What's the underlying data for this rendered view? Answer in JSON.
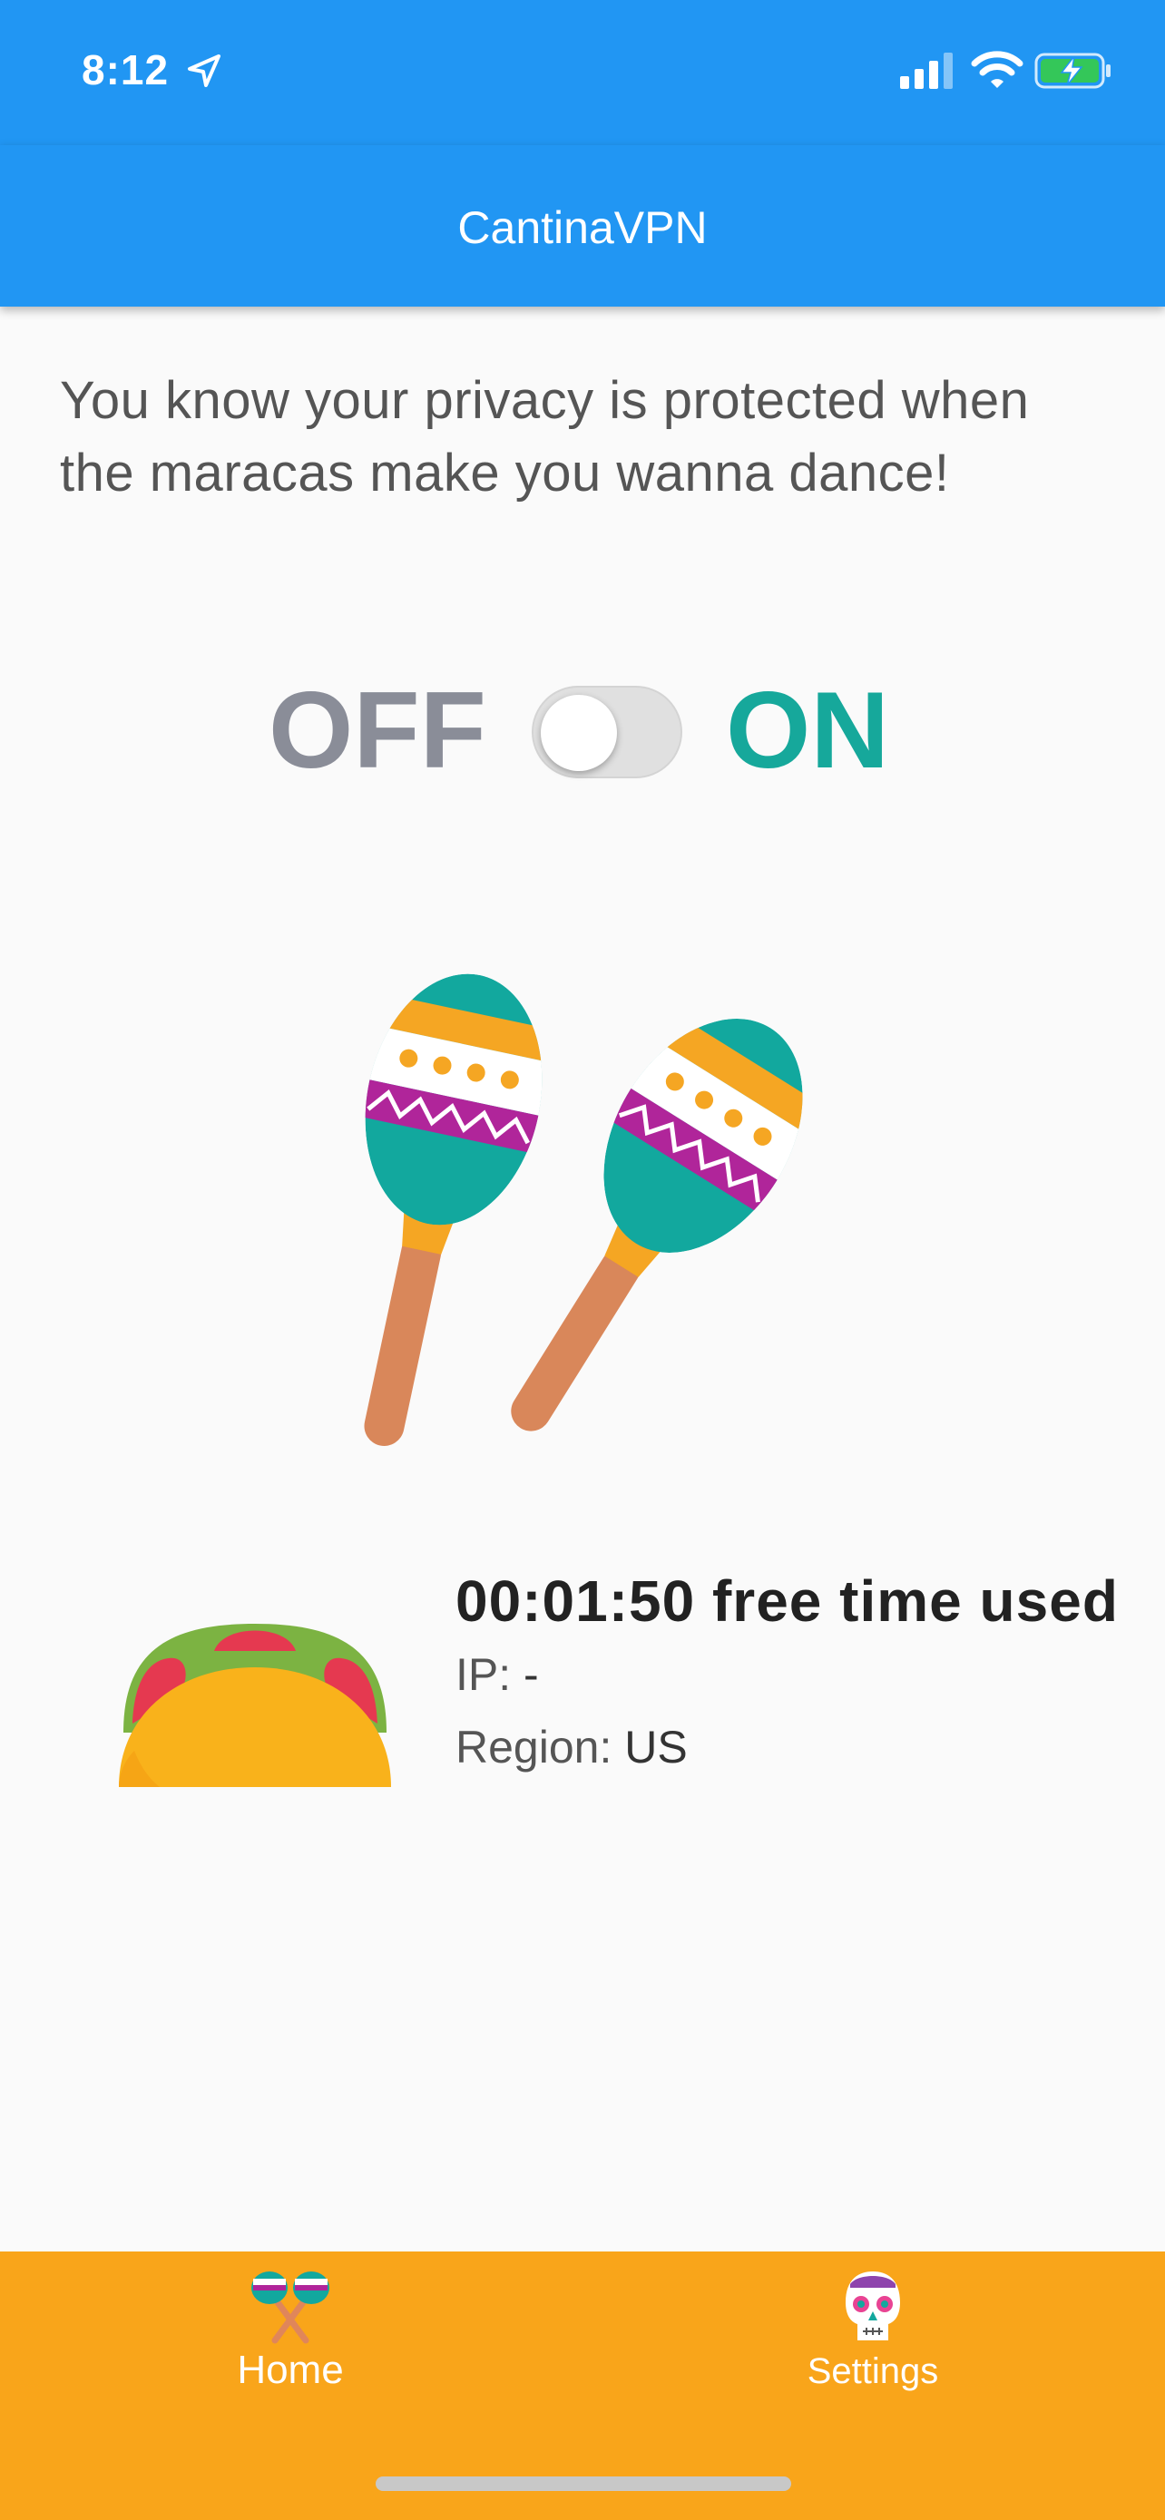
{
  "status_bar": {
    "time": "8:12"
  },
  "app_bar": {
    "title": "CantinaVPN"
  },
  "tagline": "You know your privacy is protected when the maracas make you wanna dance!",
  "toggle": {
    "off_label": "OFF",
    "on_label": "ON",
    "state": "off"
  },
  "info": {
    "time_used": "00:01:50 free time used",
    "ip_label": "IP:",
    "ip_value": "-",
    "region_label": "Region:",
    "region_value": "US"
  },
  "nav": {
    "items": [
      {
        "label": "Home",
        "icon": "maracas-icon"
      },
      {
        "label": "Settings",
        "icon": "sugar-skull-icon"
      }
    ]
  },
  "colors": {
    "app_bar": "#2196f3",
    "bottom_nav": "#f9a51a",
    "on_accent": "#16a89b",
    "off_gray": "#8a8d98"
  }
}
